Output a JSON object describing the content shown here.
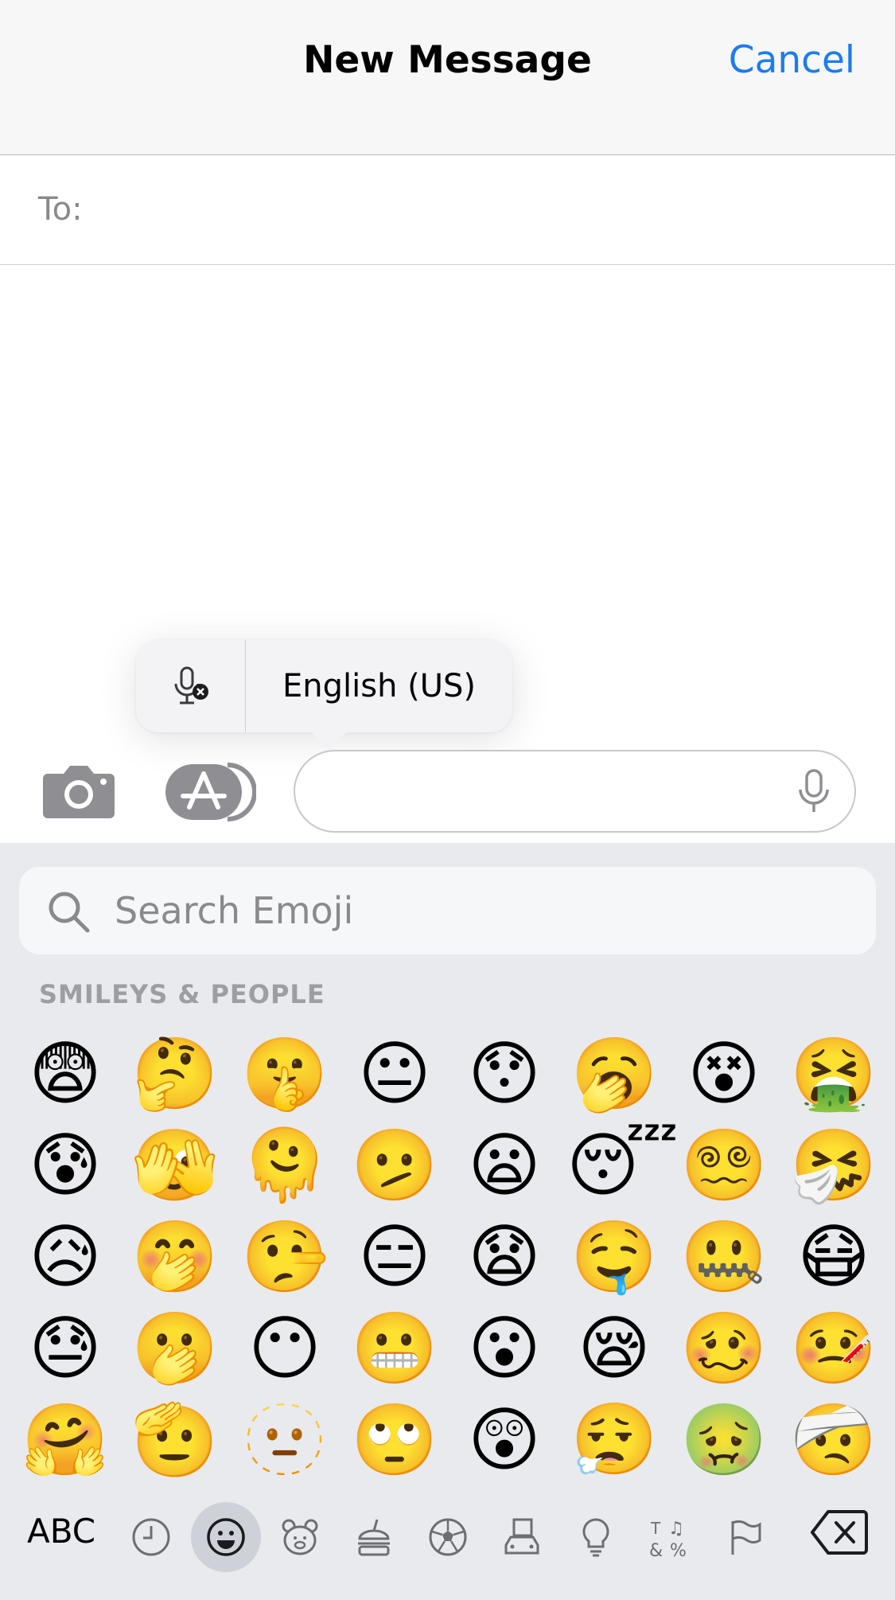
{
  "header": {
    "title": "New Message",
    "cancel_label": "Cancel"
  },
  "to_row": {
    "label": "To:",
    "value": ""
  },
  "dictation_popover": {
    "language": "English (US)"
  },
  "message_field": {
    "value": ""
  },
  "keyboard": {
    "search_placeholder": "Search Emoji",
    "section_title": "SMILEYS & PEOPLE",
    "emoji_rows": [
      [
        "😨",
        "🤔",
        "🤫",
        "😐",
        "😯",
        "🥱",
        "😵",
        "🤮"
      ],
      [
        "😰",
        "🫣",
        "🫠",
        "🫤",
        "😦",
        "😴",
        "😵‍💫",
        "🤧"
      ],
      [
        "😥",
        "🤭",
        "🤥",
        "😑",
        "😧",
        "🤤",
        "🤐",
        "😷"
      ],
      [
        "😓",
        "🫢",
        "😶",
        "😬",
        "😮",
        "😪",
        "🥴",
        "🤒"
      ],
      [
        "🤗",
        "🫡",
        "🫥",
        "🙄",
        "😲",
        "😮‍💨",
        "🤢",
        "🤕"
      ]
    ],
    "abc_label": "ABC",
    "categories": [
      "recent-icon",
      "smileys-icon",
      "animals-icon",
      "food-icon",
      "activity-icon",
      "travel-icon",
      "objects-icon",
      "symbols-icon",
      "flags-icon"
    ],
    "active_category": "smileys-icon"
  },
  "colors": {
    "accent": "#1a7cf2",
    "keyboard_bg": "#e9eaed",
    "search_bg": "#f6f7f9"
  }
}
